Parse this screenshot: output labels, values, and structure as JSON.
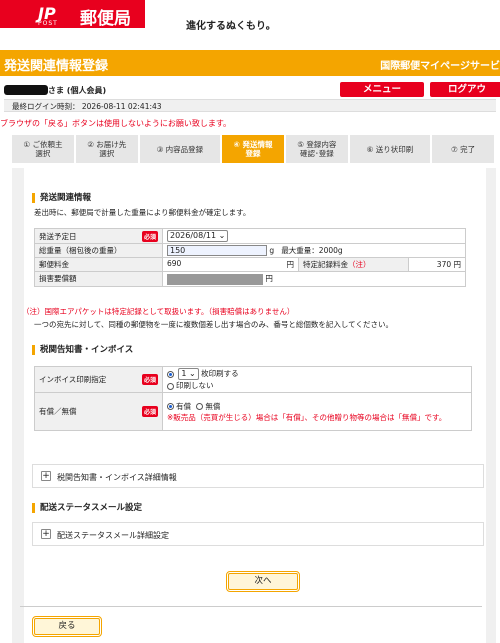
{
  "header": {
    "logo_jp": "JP",
    "logo_post": "POST",
    "logo_name": "郵便局",
    "tagline": "進化するぬくもり。"
  },
  "titlebar": {
    "title": "発送関連情報登録",
    "mypage": "国際郵便マイページサービ"
  },
  "user": {
    "name_suffix": "さま (個人会員)",
    "last_login": "最終ログイン時刻： 2026-08-11 02:41:43"
  },
  "buttons": {
    "menu": "メニュー",
    "logout": "ログアウ",
    "next": "次へ",
    "back": "戻る"
  },
  "warning": "ブラウザの「戻る」ボタンは使用しないようにお願い致します。",
  "steps": [
    {
      "label": "① ご依頼主\n選択"
    },
    {
      "label": "② お届け先\n選択"
    },
    {
      "label": "③ 内容品登録"
    },
    {
      "label": "④ 発送情報\n登録"
    },
    {
      "label": "⑤ 登録内容\n確認･登録"
    },
    {
      "label": "⑥ 送り状印刷"
    },
    {
      "label": "⑦ 完了"
    }
  ],
  "shipping": {
    "title": "発送関連情報",
    "note": "差出時に、郵便局で計量した重量により郵便料金が確定します。",
    "required": "必須",
    "date_label": "発送予定日",
    "date_value": "2026/08/11",
    "weight_label": "総重量（梱包後の重量）",
    "weight_value": "150",
    "weight_unit": "g",
    "max_weight": "最大重量：2000g",
    "postage_label": "郵便料金",
    "postage_value": "690",
    "yen": "円",
    "registered_label": "特定記録料金",
    "registered_note": "（注）",
    "registered_value": "370 円",
    "damage_label": "損害要償額",
    "footnote1_a": "（注）",
    "footnote1_b": "国際エアパケットは特定記録として取扱います。（損害賠償はありません）",
    "footnote2": "一つの宛先に対して、同種の郵便物を一度に複数個差し出す場合のみ、番号と総個数を記入してください。"
  },
  "customs": {
    "title": "税関告知書・インボイス",
    "invoice_label": "インボイス印刷指定",
    "invoice_count": "1",
    "invoice_print": "枚印刷する",
    "invoice_noprint": "印刷しない",
    "paid_label": "有償／無償",
    "paid_opt": "有償",
    "free_opt": "無償",
    "paid_note": "※販売品（売買が生じる）場合は「有償」、その他贈り物等の場合は「無償」です。",
    "detail": "税関告知書・インボイス詳細情報"
  },
  "status_mail": {
    "title": "配送ステータスメール設定",
    "detail": "配送ステータスメール詳細設定"
  },
  "colors": {
    "brand_red": "#e8001e",
    "accent_orange": "#f4a500"
  }
}
